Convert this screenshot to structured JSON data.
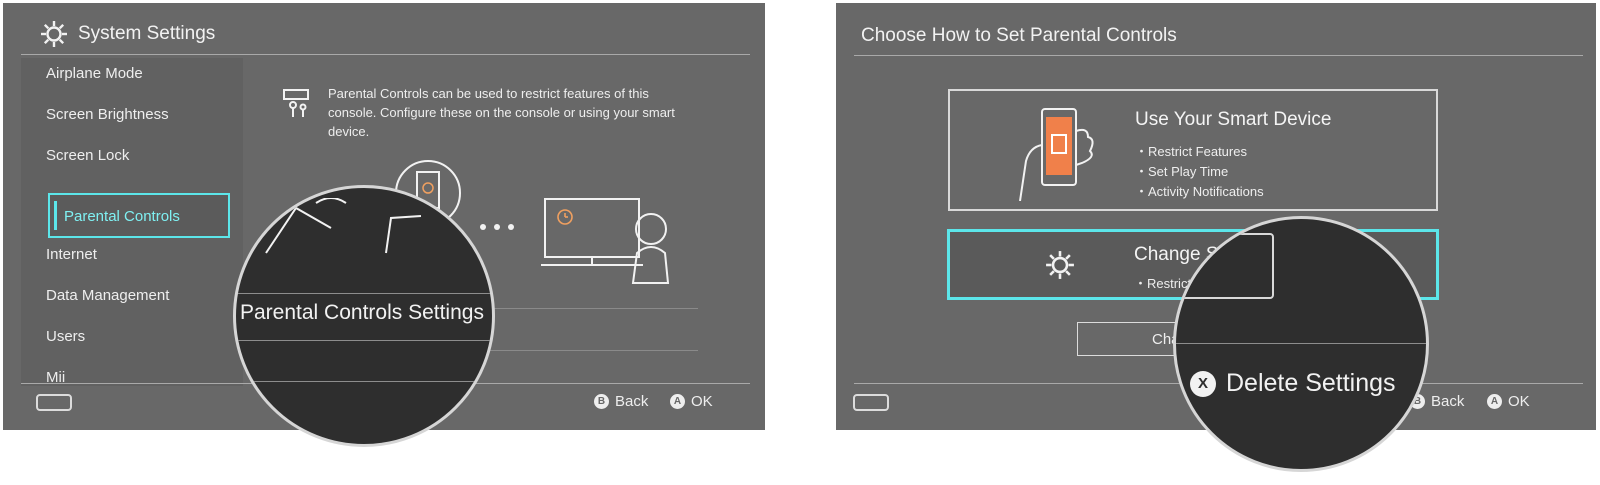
{
  "left": {
    "title": "System Settings",
    "sidebar": {
      "items": [
        "Airplane Mode",
        "Screen Brightness",
        "Screen Lock",
        "Internet",
        "Data Management",
        "Users",
        "Mii"
      ],
      "selected": "Parental Controls"
    },
    "description": "Parental Controls can be used to restrict features of this console. Configure these on the console or using your smart device.",
    "magnifier_label": "Parental Controls Settings",
    "footer": {
      "back_label": "Back",
      "back_key": "B",
      "ok_label": "OK",
      "ok_key": "A"
    },
    "icons": [
      "gear-icon",
      "parental-controls-icon",
      "console-icon",
      "alarm-clock-icon"
    ]
  },
  "right": {
    "title": "Choose How to Set Parental Controls",
    "smart_device_option": {
      "title": "Use Your Smart Device",
      "bullets": [
        "・Restrict Features",
        "・Set Play Time",
        "・Activity Notifications"
      ]
    },
    "console_option": {
      "title_partial": "Change S",
      "bullet_partial": "・Restrict"
    },
    "small_button_partial": "Cha",
    "magnifier_label": "Delete Settings",
    "magnifier_key": "X",
    "footer": {
      "back_label": "Back",
      "back_key": "B",
      "ok_label": "OK",
      "ok_key": "A"
    },
    "colors": {
      "accent": "#5ce6ea",
      "phone_screen": "#f0804a"
    }
  }
}
